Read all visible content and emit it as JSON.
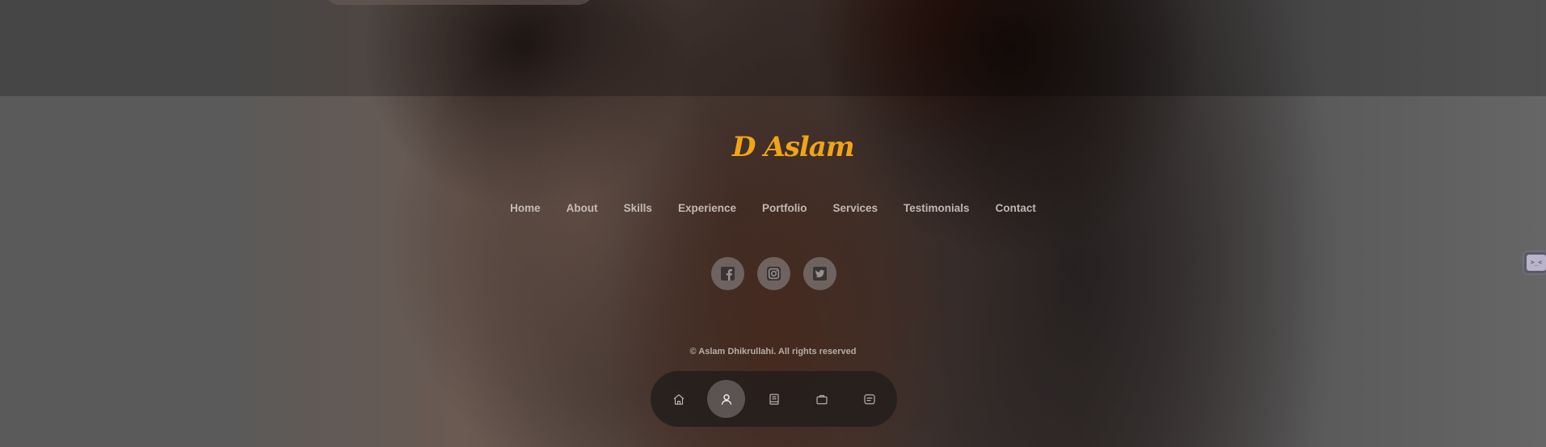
{
  "brand": {
    "logo_text": "D Aslam",
    "logo_color": "#f0a418"
  },
  "nav": {
    "links": [
      {
        "label": "Home"
      },
      {
        "label": "About"
      },
      {
        "label": "Skills"
      },
      {
        "label": "Experience"
      },
      {
        "label": "Portfolio"
      },
      {
        "label": "Services"
      },
      {
        "label": "Testimonials"
      },
      {
        "label": "Contact"
      }
    ]
  },
  "social": {
    "icons": [
      "facebook-icon",
      "instagram-icon",
      "twitter-icon"
    ]
  },
  "footer": {
    "copyright": "© Aslam Dhikrullahi. All rights reserved"
  },
  "dock": {
    "items": [
      {
        "icon": "home-icon",
        "active": false
      },
      {
        "icon": "user-icon",
        "active": true
      },
      {
        "icon": "book-icon",
        "active": false
      },
      {
        "icon": "briefcase-icon",
        "active": false
      },
      {
        "icon": "message-icon",
        "active": false
      }
    ]
  },
  "side_widget": {
    "label": ">_<"
  }
}
